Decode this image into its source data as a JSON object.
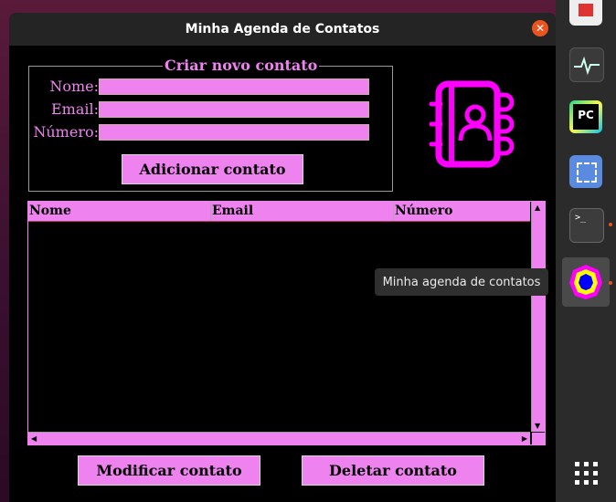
{
  "window": {
    "title": "Minha Agenda de Contatos",
    "close_glyph": "✕"
  },
  "form": {
    "legend": "Criar novo contato",
    "fields": [
      {
        "label": "Nome:",
        "value": ""
      },
      {
        "label": "Email:",
        "value": ""
      },
      {
        "label": "Número:",
        "value": ""
      }
    ],
    "add_button": "Adicionar contato"
  },
  "icon": {
    "name": "contact-book-icon",
    "color": "#ff00ff"
  },
  "table": {
    "columns": [
      "Nome",
      "Email",
      "Número"
    ],
    "rows": []
  },
  "actions": {
    "modify_button": "Modificar contato",
    "delete_button": "Deletar contato"
  },
  "dock": {
    "tooltip": "Minha agenda de contatos",
    "items": [
      "download-icon",
      "system-monitor-icon",
      "pycharm-icon",
      "screenshot-icon",
      "terminal-icon",
      "agenda-app-icon",
      "app-grid-icon"
    ]
  },
  "colors": {
    "accent": "#ee82ee",
    "bg": "#000000"
  }
}
